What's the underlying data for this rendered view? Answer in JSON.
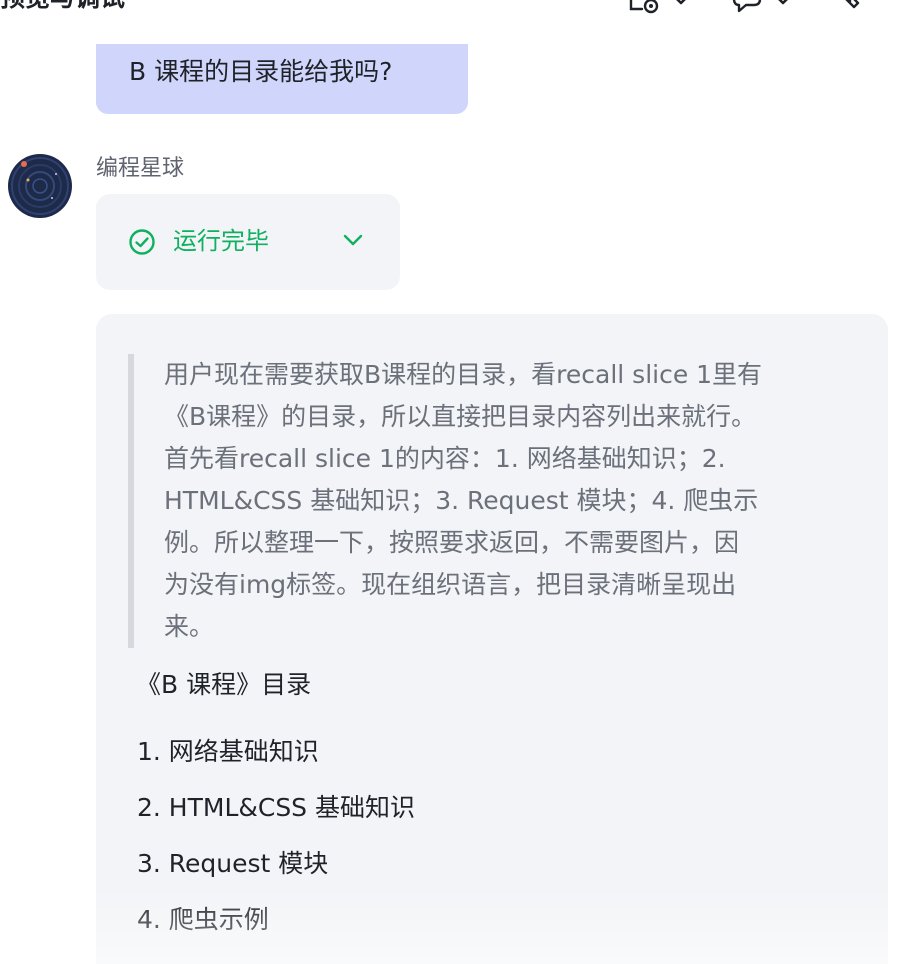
{
  "header": {
    "title": "预览与调试",
    "icons": [
      "debug-settings-icon",
      "chevron-down-icon",
      "bot-switch-icon",
      "chevron-down-icon",
      "clear-icon"
    ]
  },
  "conversation": {
    "user_message": "B 课程的目录能给我吗?",
    "bot_name": "编程星球",
    "run_status": "运行完毕",
    "reasoning_lines": [
      "用户现在需要获取B课程的目录，看recall slice 1里有",
      "《B课程》的目录，所以直接把目录内容列出来就行。",
      "首先看recall slice 1的内容：1. 网络基础知识；2.",
      "HTML&CSS 基础知识；3. Request 模块；4. 爬虫示",
      "例。所以整理一下，按照要求返回，不需要图片，因",
      "为没有img标签。现在组织语言，把目录清晰呈现出",
      "来。"
    ],
    "answer_title": "《B 课程》目录",
    "toc_items": [
      "1. 网络基础知识",
      "2. HTML&CSS 基础知识",
      "3. Request 模块",
      "4. 爬虫示例"
    ]
  },
  "colors": {
    "user_bubble": "#d0d5fb",
    "card_bg": "#f3f4f7",
    "success": "#0fb05f",
    "reasoning_text": "#6b707a",
    "reasoning_border": "#d6d8de"
  }
}
